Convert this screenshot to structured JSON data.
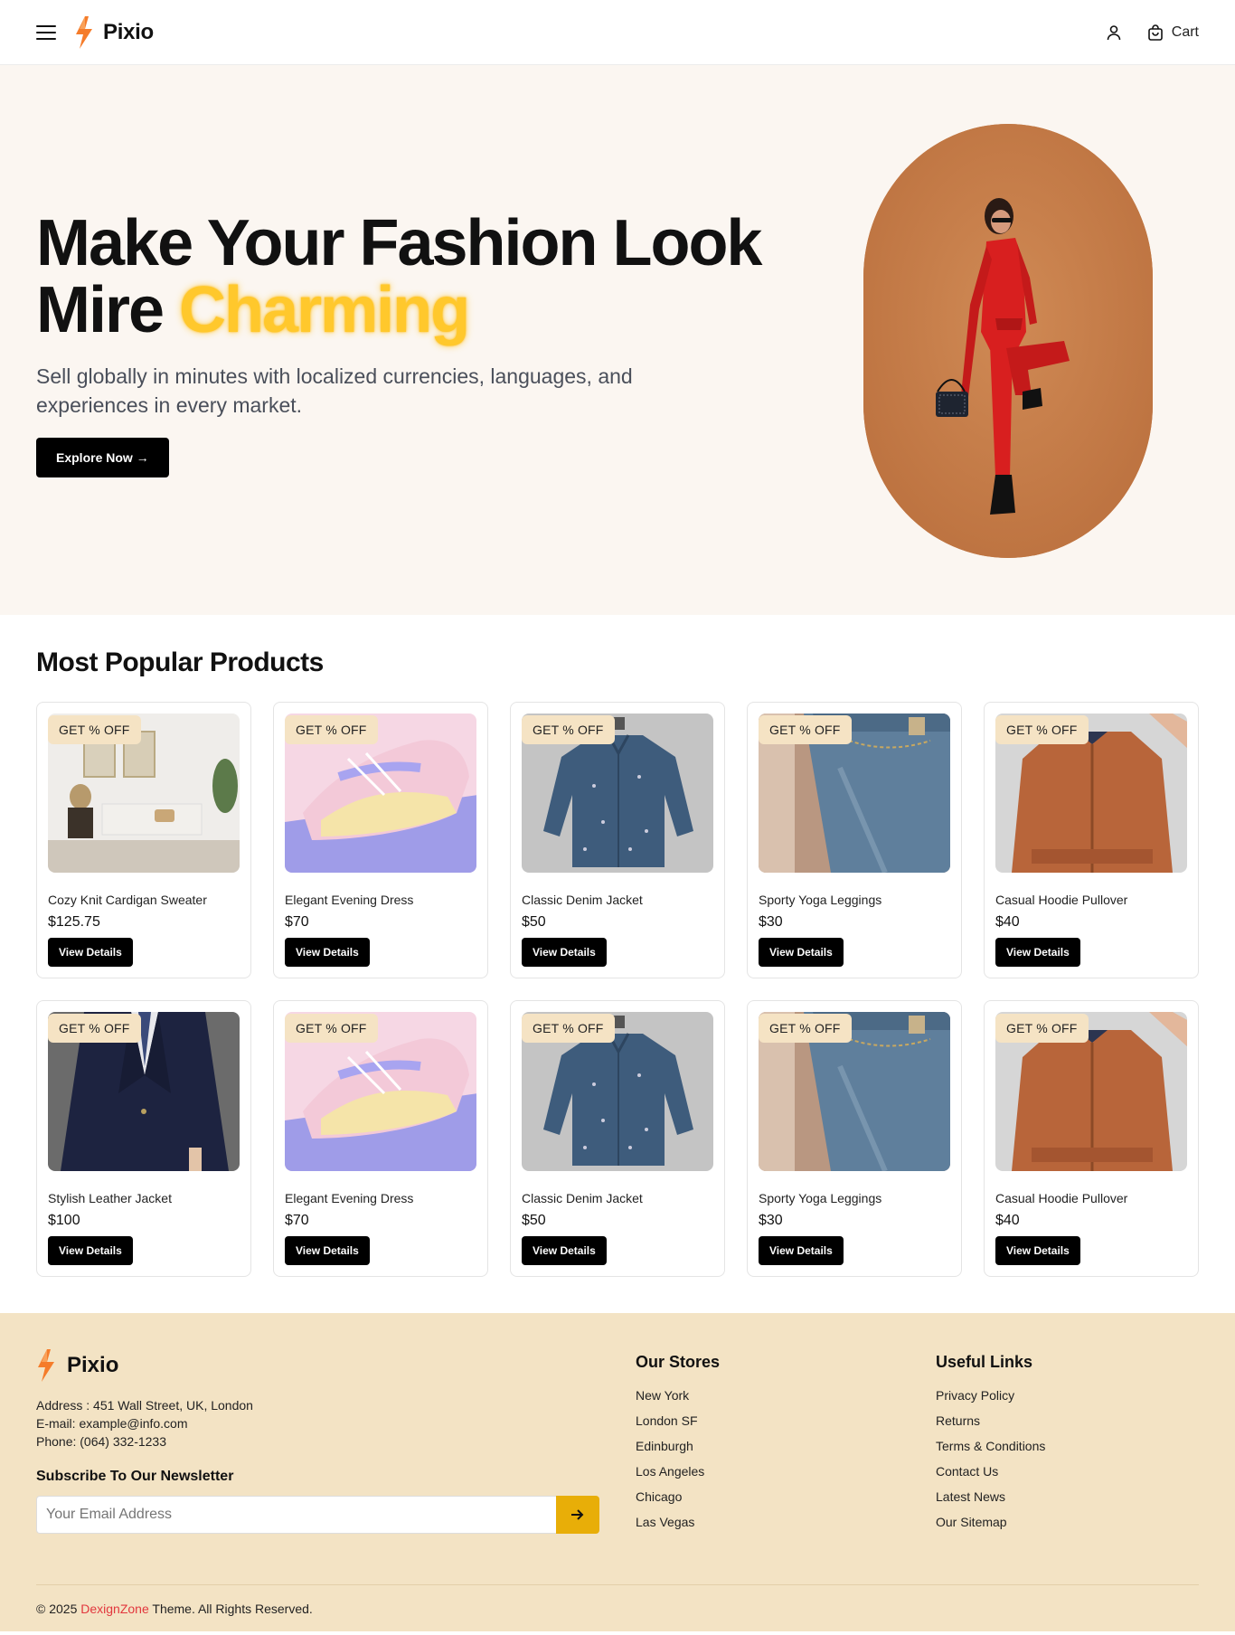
{
  "header": {
    "logo_text": "Pixio",
    "cart_label": "Cart"
  },
  "hero": {
    "title_line1": "Make Your Fashion Look",
    "title_line2_prefix": "Mire ",
    "title_line2_accent": "Charming",
    "subtitle": "Sell globally in minutes with localized currencies, languages, and experiences in every market.",
    "cta_label": "Explore Now →"
  },
  "products": {
    "section_title": "Most Popular Products",
    "badge_text": "GET % OFF",
    "button_label": "View Details",
    "items": [
      {
        "name": "Cozy Knit Cardigan Sweater",
        "price": "$125.75",
        "image": "living-room"
      },
      {
        "name": "Elegant Evening Dress",
        "price": "$70",
        "image": "sneaker"
      },
      {
        "name": "Classic Denim Jacket",
        "price": "$50",
        "image": "denim-shirt"
      },
      {
        "name": "Sporty Yoga Leggings",
        "price": "$30",
        "image": "jeans"
      },
      {
        "name": "Casual Hoodie Pullover",
        "price": "$40",
        "image": "bomber-jacket"
      },
      {
        "name": "Stylish Leather Jacket",
        "price": "$100",
        "image": "suit"
      },
      {
        "name": "Elegant Evening Dress",
        "price": "$70",
        "image": "sneaker"
      },
      {
        "name": "Classic Denim Jacket",
        "price": "$50",
        "image": "denim-shirt"
      },
      {
        "name": "Sporty Yoga Leggings",
        "price": "$30",
        "image": "jeans"
      },
      {
        "name": "Casual Hoodie Pullover",
        "price": "$40",
        "image": "bomber-jacket"
      }
    ]
  },
  "footer": {
    "logo_text": "Pixio",
    "address": "Address : 451 Wall Street, UK, London",
    "email": "E-mail: example@info.com",
    "phone": "Phone: (064) 332-1233",
    "newsletter_title": "Subscribe To Our Newsletter",
    "email_placeholder": "Your Email Address",
    "stores_title": "Our Stores",
    "stores": [
      "New York",
      "London SF",
      "Edinburgh",
      "Los Angeles",
      "Chicago",
      "Las Vegas"
    ],
    "links_title": "Useful Links",
    "links": [
      "Privacy Policy",
      "Returns",
      "Terms & Conditions",
      "Contact Us",
      "Latest News",
      "Our Sitemap"
    ],
    "copyright_prefix": "© 2025 ",
    "copyright_brand": "DexignZone",
    "copyright_suffix": " Theme. All Rights Reserved."
  },
  "colors": {
    "accent": "#ffc82c",
    "hero_bg": "#fbf6f1",
    "footer_bg": "#f3e3c4",
    "submit_bg": "#e8ae08",
    "brand_link": "#e2373d"
  }
}
